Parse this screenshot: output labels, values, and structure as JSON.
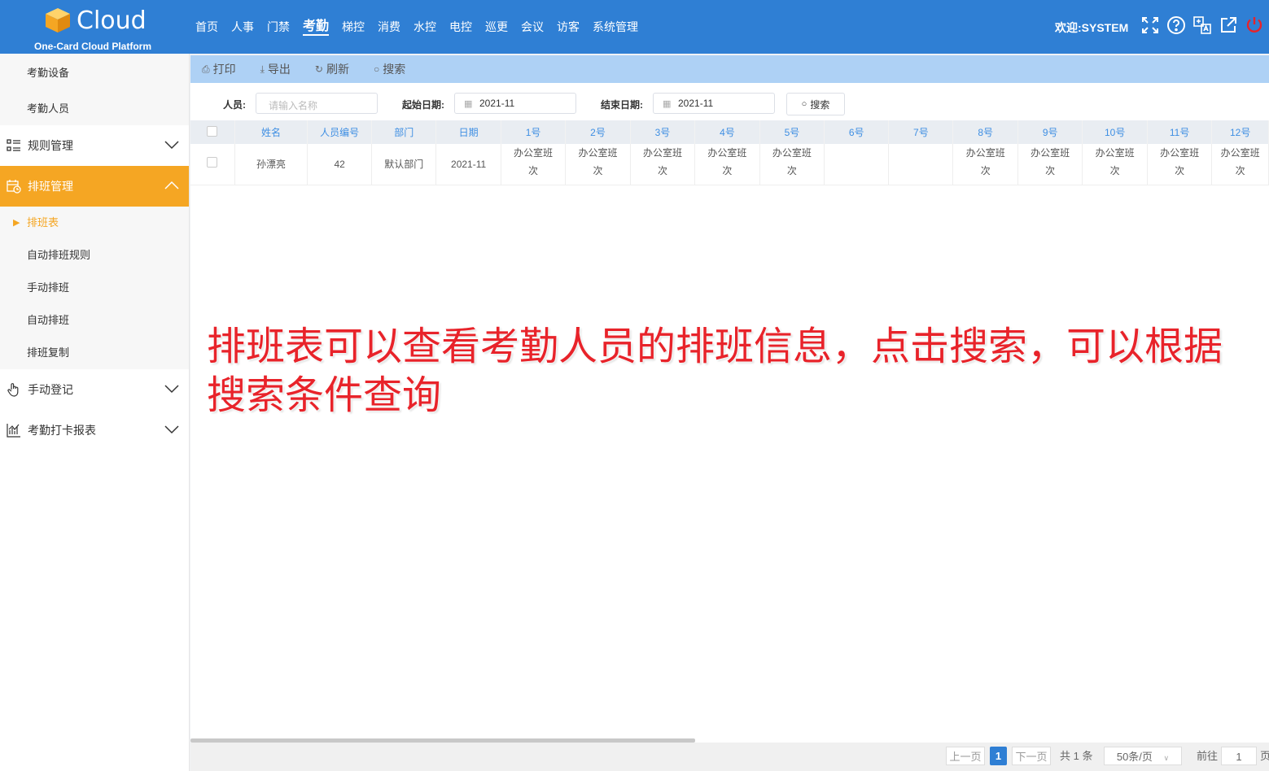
{
  "header": {
    "logo_word": "Cloud",
    "logo_sub": "One-Card Cloud Platform",
    "nav": [
      "首页",
      "人事",
      "门禁",
      "考勤",
      "梯控",
      "消费",
      "水控",
      "电控",
      "巡更",
      "会议",
      "访客",
      "系统管理"
    ],
    "active_nav": "考勤",
    "welcome": "欢迎:SYSTEM",
    "icons": [
      "fullscreen-icon",
      "help-icon",
      "language-icon",
      "external-link-icon",
      "power-icon"
    ],
    "colors": {
      "bar": "#2f7fd4",
      "power": "#e8232a"
    }
  },
  "sidebar": {
    "top_items": [
      "考勤设备",
      "考勤人员"
    ],
    "groups": {
      "rules": "规则管理",
      "schedule": "排班管理",
      "manual": "手动登记",
      "report": "考勤打卡报表"
    },
    "schedule_items": [
      "排班表",
      "自动排班规则",
      "手动排班",
      "自动排班",
      "排班复制"
    ],
    "accent": "#f5a623"
  },
  "toolbar": {
    "print": "打印",
    "export": "导出",
    "refresh": "刷新",
    "search": "搜索"
  },
  "filters": {
    "person_label": "人员:",
    "person_placeholder": "请输入名称",
    "start_label": "起始日期:",
    "start_value": "2021-11",
    "end_label": "结束日期:",
    "end_value": "2021-11",
    "search_button": "搜索"
  },
  "table": {
    "headers": [
      "姓名",
      "人员编号",
      "部门",
      "日期",
      "1号",
      "2号",
      "3号",
      "4号",
      "5号",
      "6号",
      "7号",
      "8号",
      "9号",
      "10号",
      "11号",
      "12号"
    ],
    "row": {
      "name": "孙漂亮",
      "id": "42",
      "dept": "默认部门",
      "date": "2021-11",
      "d1": "办公室班次",
      "d2": "办公室班次",
      "d3": "办公室班次",
      "d4": "办公室班次",
      "d5": "办公室班次",
      "d6": "",
      "d7": "",
      "d8": "办公室班次",
      "d9": "办公室班次",
      "d10": "办公室班次",
      "d11": "办公室班次",
      "d12": "办公室班次"
    }
  },
  "overlay_text": "排班表可以查看考勤人员的排班信息，点击搜索，可以根据搜索条件查询",
  "pager": {
    "prev": "上一页",
    "current": "1",
    "next": "下一页",
    "total": "共 1 条",
    "page_size": "50条/页",
    "goto": "前往",
    "goto_value": "1",
    "page_suffix": "页"
  }
}
